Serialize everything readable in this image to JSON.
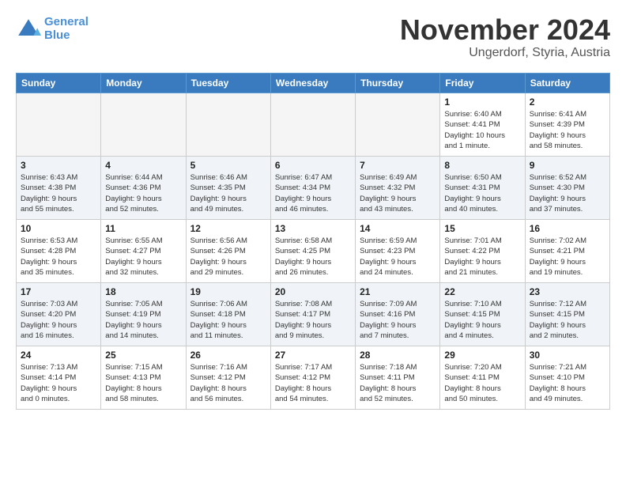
{
  "logo": {
    "line1": "General",
    "line2": "Blue"
  },
  "title": "November 2024",
  "location": "Ungerdorf, Styria, Austria",
  "weekdays": [
    "Sunday",
    "Monday",
    "Tuesday",
    "Wednesday",
    "Thursday",
    "Friday",
    "Saturday"
  ],
  "weeks": [
    [
      {
        "day": "",
        "info": ""
      },
      {
        "day": "",
        "info": ""
      },
      {
        "day": "",
        "info": ""
      },
      {
        "day": "",
        "info": ""
      },
      {
        "day": "",
        "info": ""
      },
      {
        "day": "1",
        "info": "Sunrise: 6:40 AM\nSunset: 4:41 PM\nDaylight: 10 hours\nand 1 minute."
      },
      {
        "day": "2",
        "info": "Sunrise: 6:41 AM\nSunset: 4:39 PM\nDaylight: 9 hours\nand 58 minutes."
      }
    ],
    [
      {
        "day": "3",
        "info": "Sunrise: 6:43 AM\nSunset: 4:38 PM\nDaylight: 9 hours\nand 55 minutes."
      },
      {
        "day": "4",
        "info": "Sunrise: 6:44 AM\nSunset: 4:36 PM\nDaylight: 9 hours\nand 52 minutes."
      },
      {
        "day": "5",
        "info": "Sunrise: 6:46 AM\nSunset: 4:35 PM\nDaylight: 9 hours\nand 49 minutes."
      },
      {
        "day": "6",
        "info": "Sunrise: 6:47 AM\nSunset: 4:34 PM\nDaylight: 9 hours\nand 46 minutes."
      },
      {
        "day": "7",
        "info": "Sunrise: 6:49 AM\nSunset: 4:32 PM\nDaylight: 9 hours\nand 43 minutes."
      },
      {
        "day": "8",
        "info": "Sunrise: 6:50 AM\nSunset: 4:31 PM\nDaylight: 9 hours\nand 40 minutes."
      },
      {
        "day": "9",
        "info": "Sunrise: 6:52 AM\nSunset: 4:30 PM\nDaylight: 9 hours\nand 37 minutes."
      }
    ],
    [
      {
        "day": "10",
        "info": "Sunrise: 6:53 AM\nSunset: 4:28 PM\nDaylight: 9 hours\nand 35 minutes."
      },
      {
        "day": "11",
        "info": "Sunrise: 6:55 AM\nSunset: 4:27 PM\nDaylight: 9 hours\nand 32 minutes."
      },
      {
        "day": "12",
        "info": "Sunrise: 6:56 AM\nSunset: 4:26 PM\nDaylight: 9 hours\nand 29 minutes."
      },
      {
        "day": "13",
        "info": "Sunrise: 6:58 AM\nSunset: 4:25 PM\nDaylight: 9 hours\nand 26 minutes."
      },
      {
        "day": "14",
        "info": "Sunrise: 6:59 AM\nSunset: 4:23 PM\nDaylight: 9 hours\nand 24 minutes."
      },
      {
        "day": "15",
        "info": "Sunrise: 7:01 AM\nSunset: 4:22 PM\nDaylight: 9 hours\nand 21 minutes."
      },
      {
        "day": "16",
        "info": "Sunrise: 7:02 AM\nSunset: 4:21 PM\nDaylight: 9 hours\nand 19 minutes."
      }
    ],
    [
      {
        "day": "17",
        "info": "Sunrise: 7:03 AM\nSunset: 4:20 PM\nDaylight: 9 hours\nand 16 minutes."
      },
      {
        "day": "18",
        "info": "Sunrise: 7:05 AM\nSunset: 4:19 PM\nDaylight: 9 hours\nand 14 minutes."
      },
      {
        "day": "19",
        "info": "Sunrise: 7:06 AM\nSunset: 4:18 PM\nDaylight: 9 hours\nand 11 minutes."
      },
      {
        "day": "20",
        "info": "Sunrise: 7:08 AM\nSunset: 4:17 PM\nDaylight: 9 hours\nand 9 minutes."
      },
      {
        "day": "21",
        "info": "Sunrise: 7:09 AM\nSunset: 4:16 PM\nDaylight: 9 hours\nand 7 minutes."
      },
      {
        "day": "22",
        "info": "Sunrise: 7:10 AM\nSunset: 4:15 PM\nDaylight: 9 hours\nand 4 minutes."
      },
      {
        "day": "23",
        "info": "Sunrise: 7:12 AM\nSunset: 4:15 PM\nDaylight: 9 hours\nand 2 minutes."
      }
    ],
    [
      {
        "day": "24",
        "info": "Sunrise: 7:13 AM\nSunset: 4:14 PM\nDaylight: 9 hours\nand 0 minutes."
      },
      {
        "day": "25",
        "info": "Sunrise: 7:15 AM\nSunset: 4:13 PM\nDaylight: 8 hours\nand 58 minutes."
      },
      {
        "day": "26",
        "info": "Sunrise: 7:16 AM\nSunset: 4:12 PM\nDaylight: 8 hours\nand 56 minutes."
      },
      {
        "day": "27",
        "info": "Sunrise: 7:17 AM\nSunset: 4:12 PM\nDaylight: 8 hours\nand 54 minutes."
      },
      {
        "day": "28",
        "info": "Sunrise: 7:18 AM\nSunset: 4:11 PM\nDaylight: 8 hours\nand 52 minutes."
      },
      {
        "day": "29",
        "info": "Sunrise: 7:20 AM\nSunset: 4:11 PM\nDaylight: 8 hours\nand 50 minutes."
      },
      {
        "day": "30",
        "info": "Sunrise: 7:21 AM\nSunset: 4:10 PM\nDaylight: 8 hours\nand 49 minutes."
      }
    ]
  ]
}
